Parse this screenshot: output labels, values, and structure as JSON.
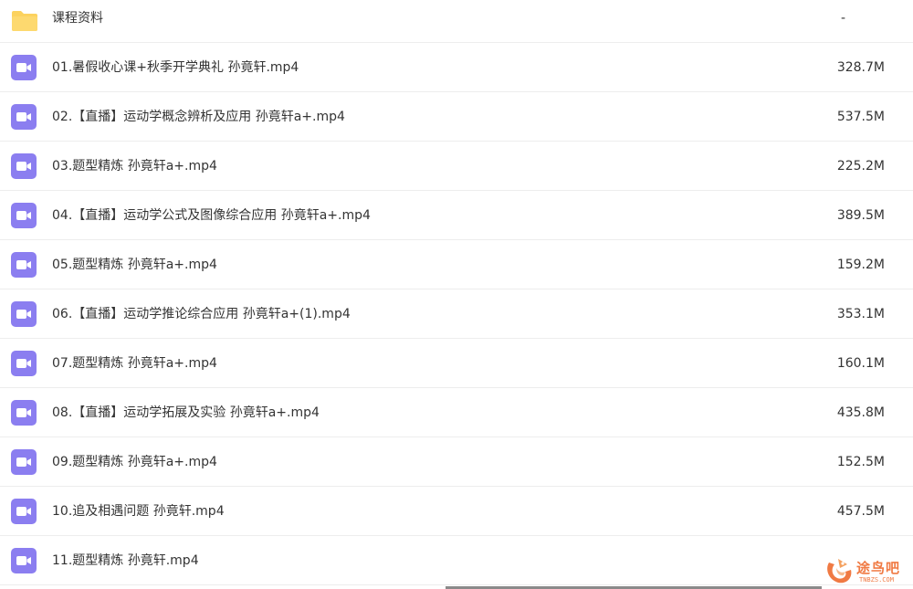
{
  "colors": {
    "folder": "#fcd25e",
    "video": "#8b7ef0",
    "text": "#333333",
    "divider": "#ededed",
    "watermark": "#f07a43"
  },
  "files": [
    {
      "name": "课程资料",
      "size": "-",
      "type": "folder",
      "icon": "folder-icon"
    },
    {
      "name": "01.暑假收心课+秋季开学典礼 孙竟轩.mp4",
      "size": "328.7M",
      "type": "video",
      "icon": "video-file-icon"
    },
    {
      "name": "02.【直播】运动学概念辨析及应用 孙竟轩a+.mp4",
      "size": "537.5M",
      "type": "video",
      "icon": "video-file-icon"
    },
    {
      "name": "03.题型精炼 孙竟轩a+.mp4",
      "size": "225.2M",
      "type": "video",
      "icon": "video-file-icon"
    },
    {
      "name": "04.【直播】运动学公式及图像综合应用 孙竟轩a+.mp4",
      "size": "389.5M",
      "type": "video",
      "icon": "video-file-icon"
    },
    {
      "name": "05.题型精炼 孙竟轩a+.mp4",
      "size": "159.2M",
      "type": "video",
      "icon": "video-file-icon"
    },
    {
      "name": "06.【直播】运动学推论综合应用 孙竟轩a+(1).mp4",
      "size": "353.1M",
      "type": "video",
      "icon": "video-file-icon"
    },
    {
      "name": "07.题型精炼 孙竟轩a+.mp4",
      "size": "160.1M",
      "type": "video",
      "icon": "video-file-icon"
    },
    {
      "name": "08.【直播】运动学拓展及实验 孙竟轩a+.mp4",
      "size": "435.8M",
      "type": "video",
      "icon": "video-file-icon"
    },
    {
      "name": "09.题型精炼 孙竟轩a+.mp4",
      "size": "152.5M",
      "type": "video",
      "icon": "video-file-icon"
    },
    {
      "name": "10.追及相遇问题 孙竟轩.mp4",
      "size": "457.5M",
      "type": "video",
      "icon": "video-file-icon"
    },
    {
      "name": "11.题型精炼 孙竟轩.mp4",
      "size": "",
      "type": "video",
      "icon": "video-file-icon"
    }
  ],
  "watermark": {
    "text": "途鸟吧",
    "subtext": "TNBZS.COM",
    "icon": "bird-logo-icon"
  }
}
